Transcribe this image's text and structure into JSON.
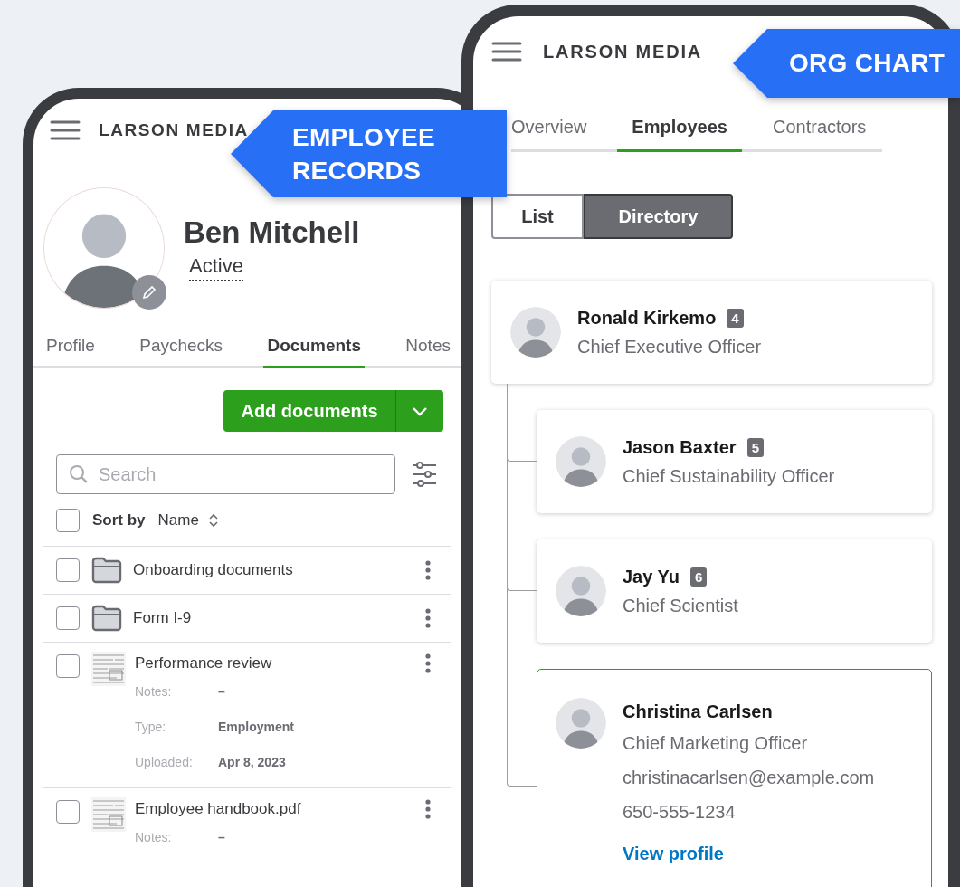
{
  "employee_records": {
    "callout": "EMPLOYEE RECORDS",
    "brand": "LARSON MEDIA",
    "profile": {
      "name": "Ben Mitchell",
      "status": "Active"
    },
    "tabs": [
      {
        "label": "Profile",
        "selected": false
      },
      {
        "label": "Paychecks",
        "selected": false
      },
      {
        "label": "Documents",
        "selected": true
      },
      {
        "label": "Notes",
        "selected": false
      }
    ],
    "add_button": "Add documents",
    "search": {
      "placeholder": "Search"
    },
    "sort": {
      "checked": false,
      "label": "Sort by",
      "field": "Name"
    },
    "documents": [
      {
        "kind": "folder",
        "name": "Onboarding documents",
        "checked": false
      },
      {
        "kind": "folder",
        "name": "Form I-9",
        "checked": false
      },
      {
        "kind": "file",
        "name": "Performance review",
        "checked": false,
        "details": [
          {
            "label": "Notes:",
            "value": "–"
          },
          {
            "label": "Type:",
            "value": "Employment"
          },
          {
            "label": "Uploaded:",
            "value": "Apr 8, 2023"
          }
        ]
      },
      {
        "kind": "file",
        "name": "Employee handbook.pdf",
        "checked": false,
        "details": [
          {
            "label": "Notes:",
            "value": "–"
          }
        ]
      }
    ]
  },
  "org_chart": {
    "callout": "ORG CHART",
    "brand": "LARSON MEDIA",
    "tabs": [
      {
        "label": "Overview",
        "selected": false
      },
      {
        "label": "Employees",
        "selected": true
      },
      {
        "label": "Contractors",
        "selected": false
      }
    ],
    "view_toggle": [
      {
        "label": "List",
        "selected": false
      },
      {
        "label": "Directory",
        "selected": true
      }
    ],
    "employees": [
      {
        "name": "Ronald Kirkemo",
        "count": "4",
        "title": "Chief Executive Officer",
        "selected": false,
        "children": [
          {
            "name": "Jason Baxter",
            "count": "5",
            "title": "Chief Sustainability Officer",
            "selected": false
          },
          {
            "name": "Jay Yu",
            "count": "6",
            "title": "Chief Scientist",
            "selected": false
          },
          {
            "name": "Christina Carlsen",
            "title": "Chief Marketing Officer",
            "email": "christinacarlsen@example.com",
            "phone": "650-555-1234",
            "link": "View profile",
            "selected": true
          }
        ]
      }
    ]
  }
}
